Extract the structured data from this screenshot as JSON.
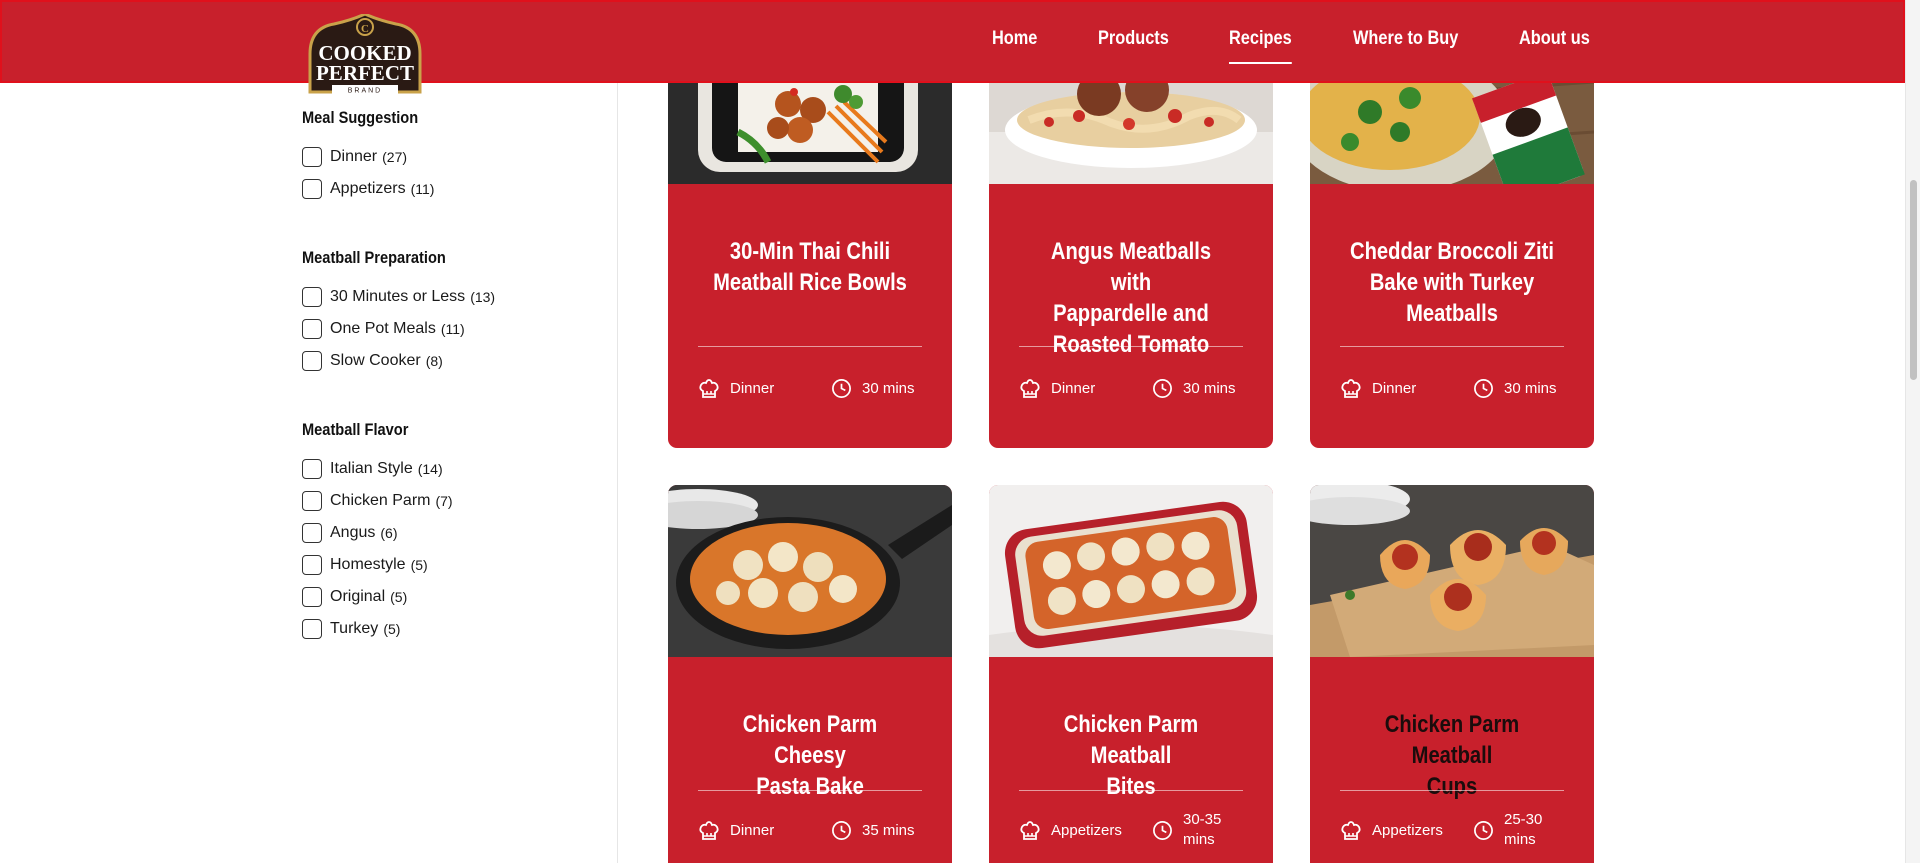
{
  "brand": {
    "logo_line1": "COOKED",
    "logo_line2": "PERFECT",
    "logo_line3": "BRAND",
    "logo_letter": "C"
  },
  "nav": [
    {
      "label": "Home"
    },
    {
      "label": "Products"
    },
    {
      "label": "Recipes",
      "active": true
    },
    {
      "label": "Where to Buy"
    },
    {
      "label": "About us"
    }
  ],
  "filters": [
    {
      "title": "Meal Suggestion",
      "options": [
        {
          "label": "Dinner",
          "count": "(27)"
        },
        {
          "label": "Appetizers",
          "count": "(11)"
        }
      ]
    },
    {
      "title": "Meatball Preparation",
      "options": [
        {
          "label": "30 Minutes or Less",
          "count": "(13)"
        },
        {
          "label": "One Pot Meals",
          "count": "(11)"
        },
        {
          "label": "Slow Cooker",
          "count": "(8)"
        }
      ]
    },
    {
      "title": "Meatball Flavor",
      "options": [
        {
          "label": "Italian Style",
          "count": "(14)"
        },
        {
          "label": "Chicken Parm",
          "count": "(7)"
        },
        {
          "label": "Angus",
          "count": "(6)"
        },
        {
          "label": "Homestyle",
          "count": "(5)"
        },
        {
          "label": "Original",
          "count": "(5)"
        },
        {
          "label": "Turkey",
          "count": "(5)"
        }
      ]
    }
  ],
  "recipes": [
    {
      "title_lines": [
        "30-Min Thai Chili",
        "Meatball Rice Bowls"
      ],
      "category": "Dinner",
      "time": "30 mins"
    },
    {
      "title_lines": [
        "Angus Meatballs with",
        "Pappardelle and",
        "Roasted Tomato"
      ],
      "category": "Dinner",
      "time": "30 mins"
    },
    {
      "title_lines": [
        "Cheddar Broccoli Ziti",
        "Bake with Turkey",
        "Meatballs"
      ],
      "category": "Dinner",
      "time": "30 mins"
    },
    {
      "title_lines": [
        "Chicken Parm Cheesy",
        "Pasta Bake"
      ],
      "category": "Dinner",
      "time": "35 mins"
    },
    {
      "title_lines": [
        "Chicken Parm Meatball",
        "Bites"
      ],
      "category": "Appetizers",
      "time_lines": [
        "30-35",
        "mins"
      ]
    },
    {
      "title_lines": [
        "Chicken Parm Meatball",
        "Cups"
      ],
      "category": "Appetizers",
      "time_lines": [
        "25-30",
        "mins"
      ]
    }
  ],
  "icons": {
    "category": "chef-hat-icon",
    "time": "clock-icon",
    "checkbox": "checkbox-icon"
  },
  "colors": {
    "brand_red": "#c8202c",
    "white": "#ffffff",
    "logo_dark": "#2a1a14",
    "logo_gold": "#c9a24a"
  }
}
